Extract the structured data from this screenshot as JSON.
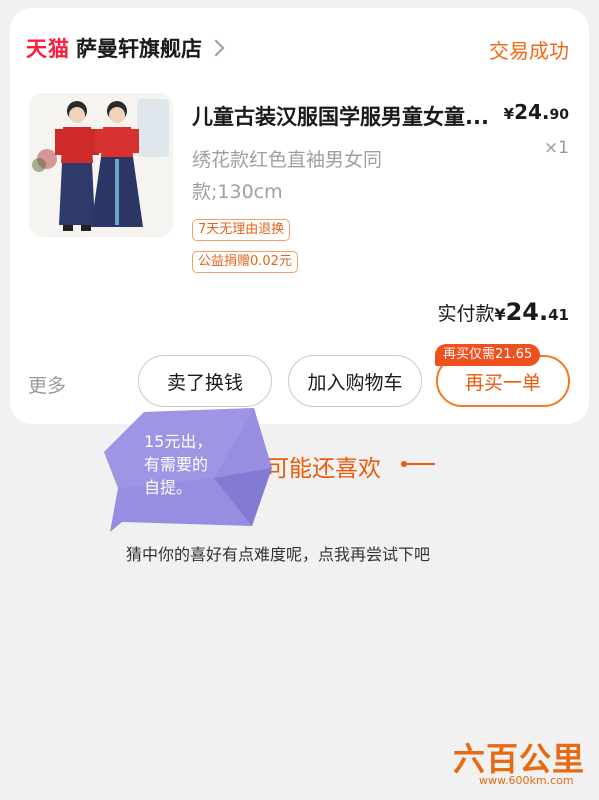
{
  "shop": {
    "platform_logo": "天猫",
    "name": "萨曼轩旗舰店",
    "status": "交易成功"
  },
  "product": {
    "title": "儿童古装汉服国学服男童女童...",
    "price_symbol": "¥",
    "price_int": "24.",
    "price_dec": "90",
    "quantity": "×1",
    "spec_line1": "绣花款红色直袖男女同",
    "spec_line2": "款;130cm",
    "tags": [
      "7天无理由退换",
      "公益捐赠0.02元"
    ]
  },
  "payment": {
    "label": "实付款",
    "symbol": "¥",
    "int": "24.",
    "dec": "41"
  },
  "actions": {
    "more": "更多",
    "sell": "卖了换钱",
    "add_cart": "加入购物车",
    "rebuy": "再买一单",
    "rebuy_promo": "再买仅需21.65"
  },
  "recommend": {
    "title": "可能还喜欢",
    "subtitle": "猜中你的喜好有点难度呢，点我再尝试下吧"
  },
  "annotation": {
    "line1": "15元出，",
    "line2": "有需要的",
    "line3": "自提。"
  },
  "watermark": {
    "logo": "六百公里",
    "url": "www.600km.com"
  },
  "colors": {
    "accent": "#ea5b0c",
    "tmall_red": "#ff1a3c",
    "bubble": "#8f86e0"
  }
}
